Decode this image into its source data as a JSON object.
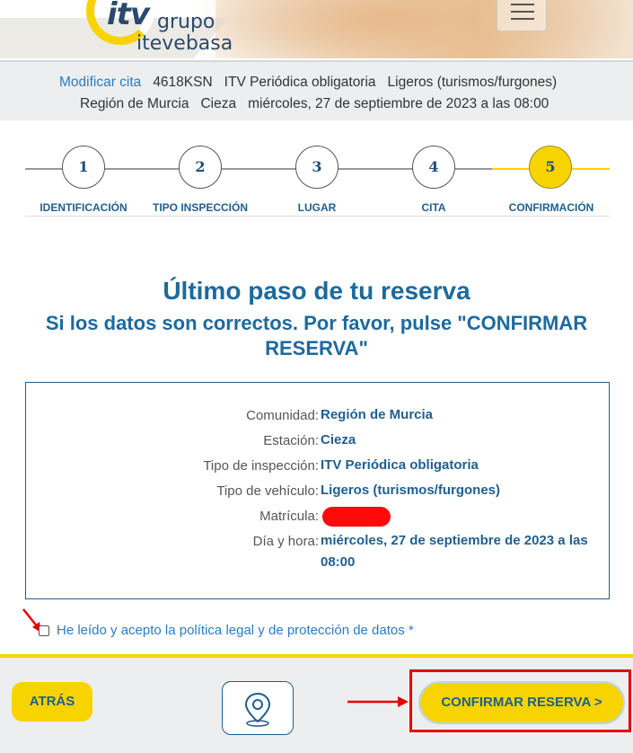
{
  "header": {
    "logo_itv": "itv",
    "logo_grupo": "grupo",
    "logo_itevebasa": "itevebasa",
    "menu_icon": "hamburger-menu-icon"
  },
  "summary": {
    "modify_link": "Modificar cita",
    "plate": "4618KSN",
    "inspection": "ITV Periódica obligatoria",
    "vehicle": "Ligeros (turismos/furgones)",
    "region": "Región de Murcia",
    "station": "Cieza",
    "datetime": "miércoles, 27 de septiembre de 2023 a las 08:00"
  },
  "steps": [
    {
      "num": "1",
      "label": "IDENTIFICACIÓN"
    },
    {
      "num": "2",
      "label": "TIPO INSPECCIÓN"
    },
    {
      "num": "3",
      "label": "LUGAR"
    },
    {
      "num": "4",
      "label": "CITA"
    },
    {
      "num": "5",
      "label": "CONFIRMACIÓN"
    }
  ],
  "active_step": 5,
  "main": {
    "title": "Último paso de tu reserva",
    "subtitle": "Si los datos son correctos. Por favor, pulse \"CONFIRMAR RESERVA\""
  },
  "details": [
    {
      "label": "Comunidad:",
      "value": "Región de Murcia"
    },
    {
      "label": "Estación:",
      "value": "Cieza"
    },
    {
      "label": "Tipo de inspección:",
      "value": "ITV Periódica obligatoria"
    },
    {
      "label": "Tipo de vehículo:",
      "value": "Ligeros (turismos/furgones)"
    },
    {
      "label": "Matrícula:",
      "value": ""
    },
    {
      "label": "Día y hora:",
      "value": "miércoles, 27 de septiembre de 2023 a las 08:00"
    }
  ],
  "consent": {
    "label": "He leído y acepto la política legal y de protección de datos *",
    "checked": false
  },
  "footer": {
    "back_label": "ATRÁS",
    "location_icon": "location-pin-icon",
    "confirm_label": "CONFIRMAR RESERVA >"
  },
  "colors": {
    "accent_yellow": "#f7d400",
    "primary_blue": "#1f5f91",
    "link_blue": "#2b7cc4",
    "annotation_red": "#e60000"
  }
}
